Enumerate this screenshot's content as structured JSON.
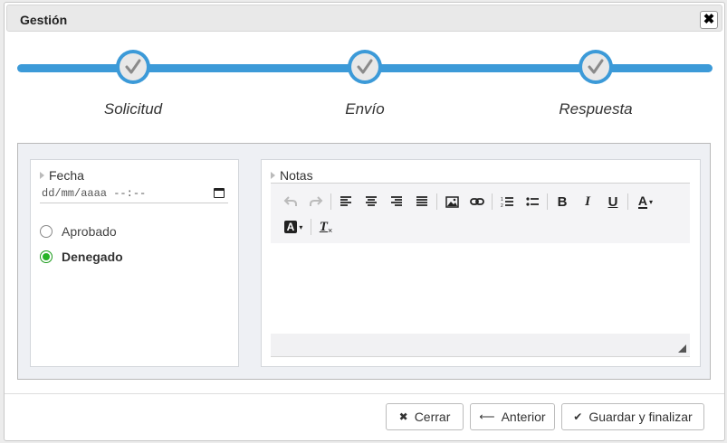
{
  "dialog": {
    "title": "Gestión",
    "close_label": "✖"
  },
  "steps": [
    {
      "label": "Solicitud",
      "completed": true
    },
    {
      "label": "Envío",
      "completed": true
    },
    {
      "label": "Respuesta",
      "completed": true
    }
  ],
  "left_panel": {
    "date_label": "Fecha",
    "date_placeholder": "dd/mm/aaaa --:--",
    "radio_options": [
      {
        "label": "Aprobado",
        "checked": false
      },
      {
        "label": "Denegado",
        "checked": true
      }
    ]
  },
  "notes": {
    "label": "Notas",
    "toolbar_icons": [
      "undo-icon",
      "redo-icon",
      "align-left-icon",
      "align-center-icon",
      "align-right-icon",
      "align-justify-icon",
      "image-icon",
      "link-icon",
      "ordered-list-icon",
      "unordered-list-icon",
      "bold-icon",
      "italic-icon",
      "underline-icon",
      "text-color-icon",
      "background-color-icon",
      "clear-format-icon"
    ],
    "bold_glyph": "B",
    "italic_glyph": "I",
    "underline_glyph": "U",
    "color_glyph": "A",
    "clear_glyph": "T"
  },
  "footer": {
    "close_label": "Cerrar",
    "previous_label": "Anterior",
    "save_label": "Guardar y finalizar"
  },
  "colors": {
    "accent": "#3c9ad8",
    "radio_checked": "#27b427"
  }
}
